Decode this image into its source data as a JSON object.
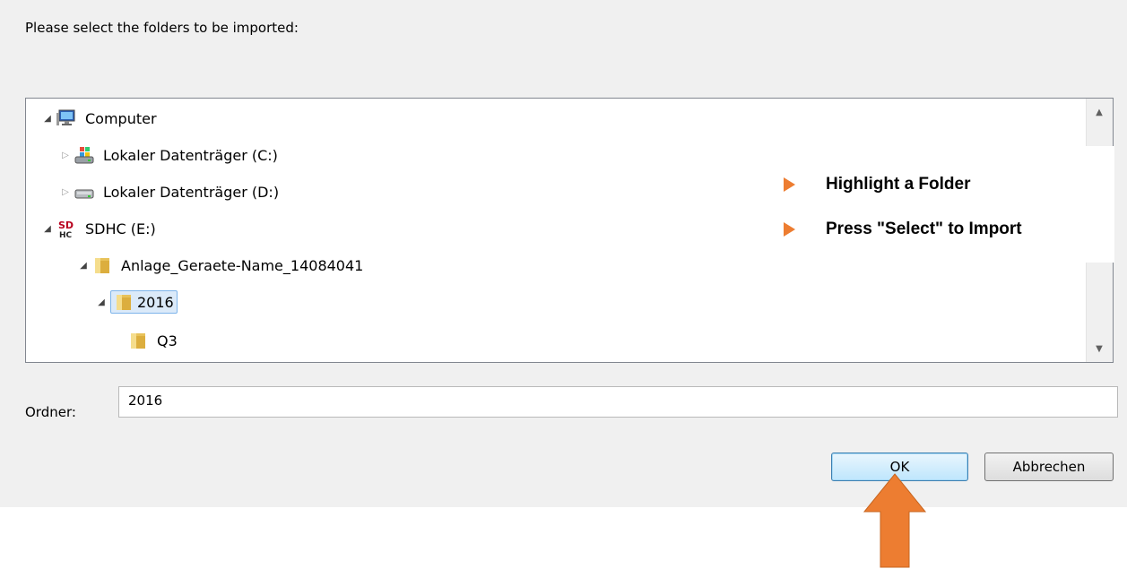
{
  "dialog": {
    "prompt": "Please select the folders to be imported:",
    "folder_label": "Ordner:",
    "folder_value": "2016",
    "ok_label": "OK",
    "cancel_label": "Abbrechen"
  },
  "tree": {
    "nodes": [
      {
        "label": "Computer",
        "icon": "computer-icon",
        "expander": "expanded"
      },
      {
        "label": "Lokaler Datenträger (C:)",
        "icon": "system-drive-icon",
        "expander": "collapsed"
      },
      {
        "label": "Lokaler Datenträger (D:)",
        "icon": "drive-icon",
        "expander": "collapsed"
      },
      {
        "label": "SDHC (E:)",
        "icon": "sd-card-icon",
        "expander": "expanded"
      },
      {
        "label": "Anlage_Geraete-Name_14084041",
        "icon": "folder-icon",
        "expander": "expanded"
      },
      {
        "label": "2016",
        "icon": "folder-icon",
        "expander": "expanded",
        "selected": true
      },
      {
        "label": "Q3",
        "icon": "folder-icon",
        "expander": "none"
      }
    ]
  },
  "callout": {
    "items": [
      "Highlight a Folder",
      "Press \"Select\" to Import"
    ],
    "accent_color": "#ed7d31"
  },
  "colors": {
    "dialog_bg": "#f0f0f0",
    "selection_bg": "#dbeaf9",
    "arrow": "#ed7d31"
  }
}
